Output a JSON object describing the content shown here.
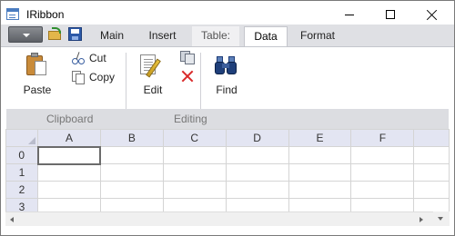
{
  "window": {
    "title": "IRibbon",
    "icon": "app-window-icon"
  },
  "quick_access": {
    "menu_icon": "chevron-down-icon",
    "open_icon": "open-folder-icon",
    "save_icon": "save-disk-icon"
  },
  "tabs": [
    {
      "label": "Main",
      "state": "normal"
    },
    {
      "label": "Insert",
      "state": "normal"
    },
    {
      "label": "Table:",
      "state": "contextual"
    },
    {
      "label": "Data",
      "state": "active"
    },
    {
      "label": "Format",
      "state": "normal"
    }
  ],
  "ribbon": {
    "groups": [
      {
        "label": "Clipboard",
        "buttons": {
          "paste": {
            "label": "Paste",
            "icon": "clipboard-paste-icon"
          },
          "cut": {
            "label": "Cut",
            "icon": "scissors-icon"
          },
          "copy": {
            "label": "Copy",
            "icon": "copy-icon"
          }
        }
      },
      {
        "label": "Editing",
        "buttons": {
          "edit": {
            "label": "Edit",
            "icon": "edit-document-icon"
          },
          "copy_format": {
            "label": "",
            "icon": "copy-format-icon"
          },
          "delete": {
            "label": "",
            "icon": "delete-x-icon"
          },
          "find": {
            "label": "Find",
            "icon": "binoculars-icon"
          }
        }
      }
    ]
  },
  "sheet": {
    "columns": [
      "A",
      "B",
      "C",
      "D",
      "E",
      "F"
    ],
    "rows": [
      "0",
      "1",
      "2",
      "3"
    ],
    "selected_cell": "A0"
  },
  "colors": {
    "accent": "#e3e5f2",
    "tab_bar": "#dfe0e4",
    "group_bar": "#dcdde1",
    "delete_red": "#d92a2a"
  }
}
